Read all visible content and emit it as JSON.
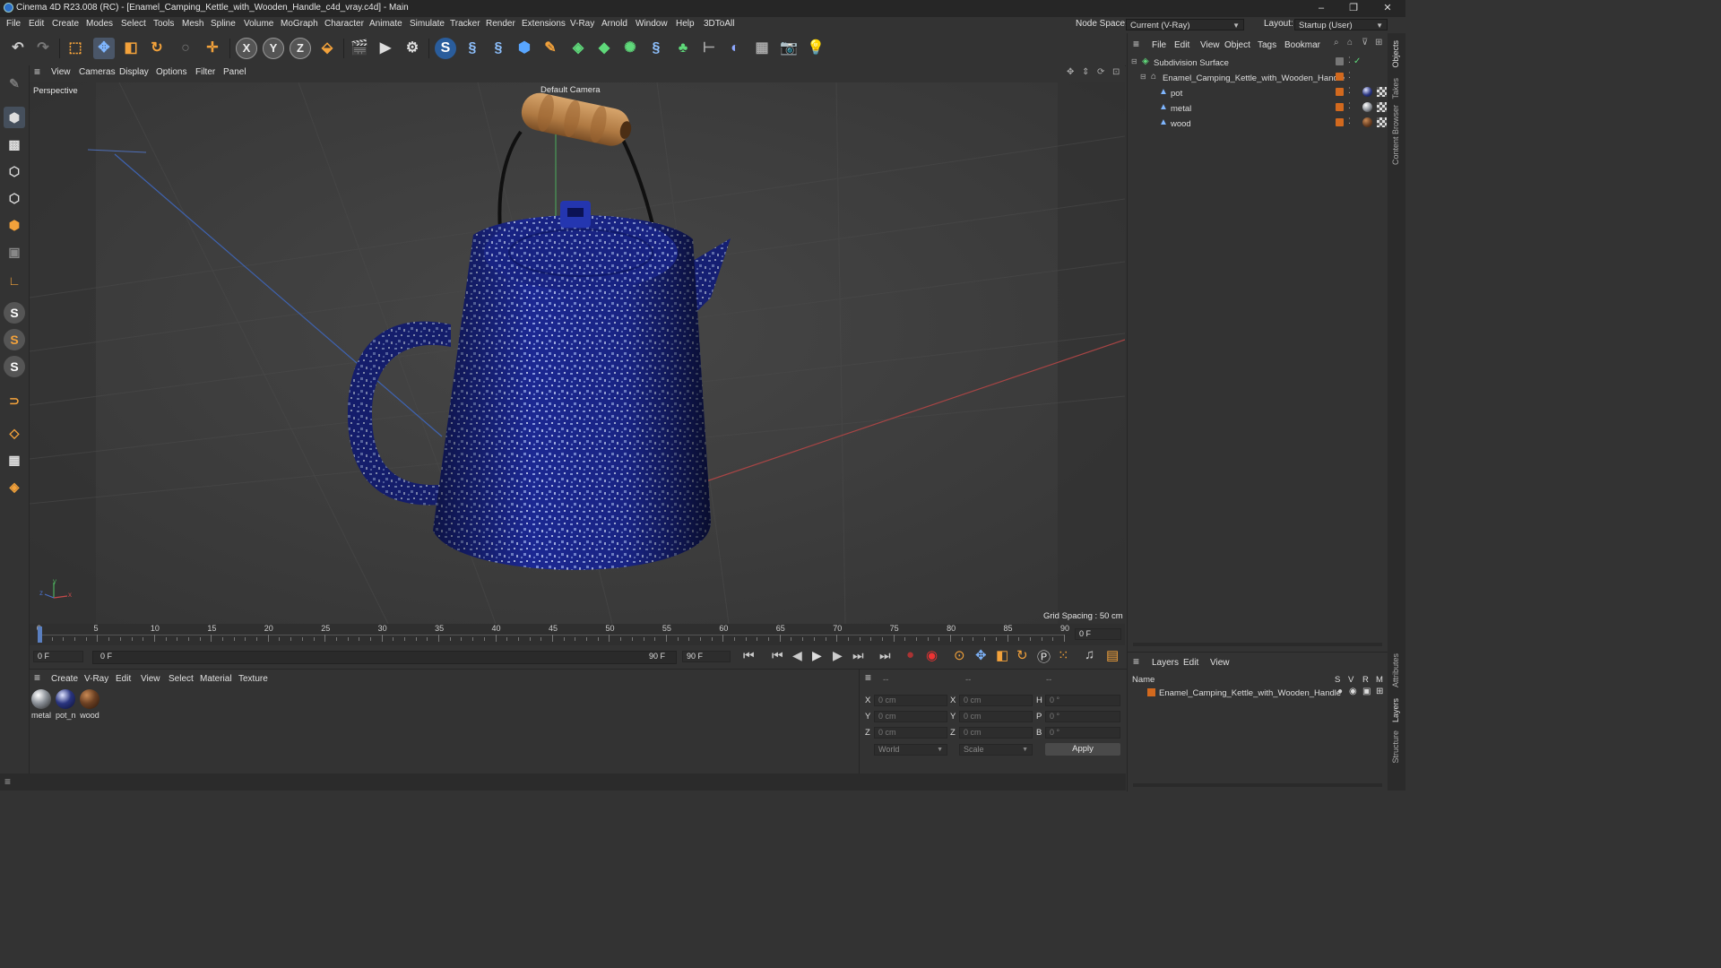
{
  "window": {
    "title": "Cinema 4D R23.008 (RC) - [Enamel_Camping_Kettle_with_Wooden_Handle_c4d_vray.c4d] - Main",
    "controls": [
      "–",
      "❐",
      "✕"
    ]
  },
  "menubar": {
    "items": [
      "File",
      "Edit",
      "Create",
      "Modes",
      "Select",
      "Tools",
      "Mesh",
      "Spline",
      "Volume",
      "MoGraph",
      "Character",
      "Animate",
      "Simulate",
      "Tracker",
      "Render",
      "Extensions",
      "V-Ray",
      "Arnold",
      "Window",
      "Help",
      "3DToAll"
    ],
    "node_space_label": "Node Space:",
    "node_space_value": "Current (V-Ray)",
    "layout_label": "Layout:",
    "layout_value": "Startup (User)"
  },
  "toolbar": {
    "axis_x": "X",
    "axis_y": "Y",
    "axis_z": "Z"
  },
  "viewport": {
    "menu": [
      "View",
      "Cameras",
      "Display",
      "Options",
      "Filter",
      "Panel"
    ],
    "view_name": "Perspective",
    "camera_name": "Default Camera",
    "grid_spacing": "Grid Spacing : 50 cm",
    "axis_labels": {
      "y": "y",
      "z": "z",
      "x": "x"
    }
  },
  "timeline": {
    "ticks": [
      "0",
      "5",
      "10",
      "15",
      "20",
      "25",
      "30",
      "35",
      "40",
      "45",
      "50",
      "55",
      "60",
      "65",
      "70",
      "75",
      "80",
      "85",
      "90"
    ],
    "current_frame_right": "0 F",
    "start_frame": "0 F",
    "range_start": "0 F",
    "range_end": "90 F",
    "end_frame": "90 F"
  },
  "material_manager": {
    "menu": [
      "Create",
      "V-Ray",
      "Edit",
      "View",
      "Select",
      "Material",
      "Texture"
    ],
    "materials": [
      {
        "name": "metal",
        "color": "#8a8f96"
      },
      {
        "name": "pot_n",
        "color": "#2a3580"
      },
      {
        "name": "wood",
        "color": "#6b4023"
      }
    ]
  },
  "attributes": {
    "header_dashes": [
      "--",
      "--",
      "--"
    ],
    "rows": [
      {
        "a": "X",
        "av": "0 cm",
        "b": "X",
        "bv": "0 cm",
        "c": "H",
        "cv": "0 °"
      },
      {
        "a": "Y",
        "av": "0 cm",
        "b": "Y",
        "bv": "0 cm",
        "c": "P",
        "cv": "0 °"
      },
      {
        "a": "Z",
        "av": "0 cm",
        "b": "Z",
        "bv": "0 cm",
        "c": "B",
        "cv": "0 °"
      }
    ],
    "coord_mode": "World",
    "scale_mode": "Scale",
    "apply_label": "Apply"
  },
  "object_manager": {
    "menu": [
      "File",
      "Edit",
      "View",
      "Object",
      "Tags",
      "Bookmar"
    ],
    "objects": [
      {
        "name": "Subdivision Surface",
        "level": 0
      },
      {
        "name": "Enamel_Camping_Kettle_with_Wooden_Handle",
        "level": 1
      },
      {
        "name": "pot",
        "level": 2
      },
      {
        "name": "metal",
        "level": 2
      },
      {
        "name": "wood",
        "level": 2
      }
    ]
  },
  "layers": {
    "menu": [
      "Layers",
      "Edit",
      "View"
    ],
    "col_name": "Name",
    "cols": [
      "S",
      "V",
      "R",
      "M"
    ],
    "items": [
      {
        "name": "Enamel_Camping_Kettle_with_Wooden_Handle",
        "color": "#d2691e"
      }
    ]
  },
  "right_strip": [
    "Objects",
    "Takes",
    "Content Browser",
    "Attributes",
    "Layers",
    "Structure"
  ]
}
